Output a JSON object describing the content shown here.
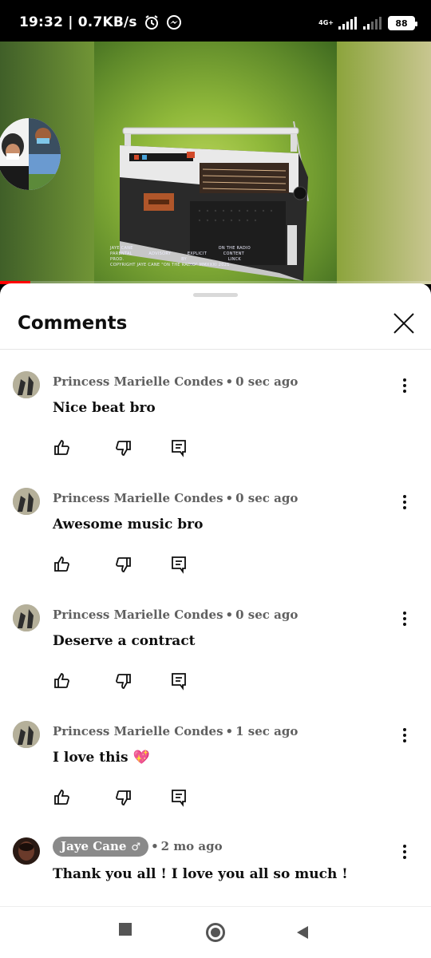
{
  "status_bar": {
    "time_speed": "19:32 | 0.7KB/s",
    "network_tag": "4G+",
    "battery": "88"
  },
  "video": {
    "cover_text": {
      "artist": "JAYE CANE",
      "title": "ON THE RADIO",
      "line2_left": "PARENTAL",
      "line2_mid1": "ADVISORY",
      "line2_mid2": "EXPLICIT",
      "line2_right": "CONTENT",
      "line3_left": "PROD.",
      "line3_mid": "BY",
      "line3_right": "LINCK",
      "copyright": "COPYRIGHT JAYE CANE \"ON THE RADIO\" MMXXXI 2021"
    },
    "progress": 0.07
  },
  "sheet": {
    "title": "Comments"
  },
  "comments": [
    {
      "author": "Princess Marielle Condes",
      "time": "0 sec ago",
      "text": "Nice beat bro",
      "is_creator": false
    },
    {
      "author": "Princess Marielle Condes",
      "time": "0 sec ago",
      "text": "Awesome music bro",
      "is_creator": false
    },
    {
      "author": "Princess Marielle Condes",
      "time": "0 sec ago",
      "text": "Deserve a contract",
      "is_creator": false
    },
    {
      "author": "Princess Marielle Condes",
      "time": "1 sec ago",
      "text": "I love this 💖",
      "is_creator": false
    },
    {
      "author": "Jaye Cane",
      "time": "2 mo ago",
      "text": "Thank you all ! I love you all so much !",
      "is_creator": true,
      "badge_icon": "music-note-icon"
    }
  ],
  "colors": {
    "progress": "#ff0000",
    "creator_chip": "#8a8a8a",
    "meta_text": "#606060"
  }
}
